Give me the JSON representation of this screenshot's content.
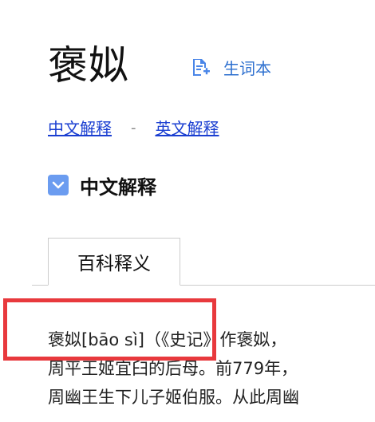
{
  "entry": {
    "word": "褒姒"
  },
  "vocab_button": {
    "label": "生词本",
    "icon": "add-to-wordbook-icon"
  },
  "nav_links": {
    "chinese": "中文解释",
    "separator": "-",
    "english": "英文解释"
  },
  "section": {
    "title": "中文解释",
    "icon": "checkbox-checked-icon"
  },
  "tabs": [
    {
      "label": "百科释义",
      "active": true
    }
  ],
  "content": {
    "lines": [
      "褒姒[bāo sì]（《史记》作褒姒，",
      "周平王姬宜臼的后母。前779年，",
      "周幽王生下儿子姬伯服。从此周幽"
    ]
  },
  "colors": {
    "link": "#1a3ed1",
    "accent": "#2c6fcf",
    "checkbox": "#6b9cf0",
    "highlight": "#e8393d"
  }
}
